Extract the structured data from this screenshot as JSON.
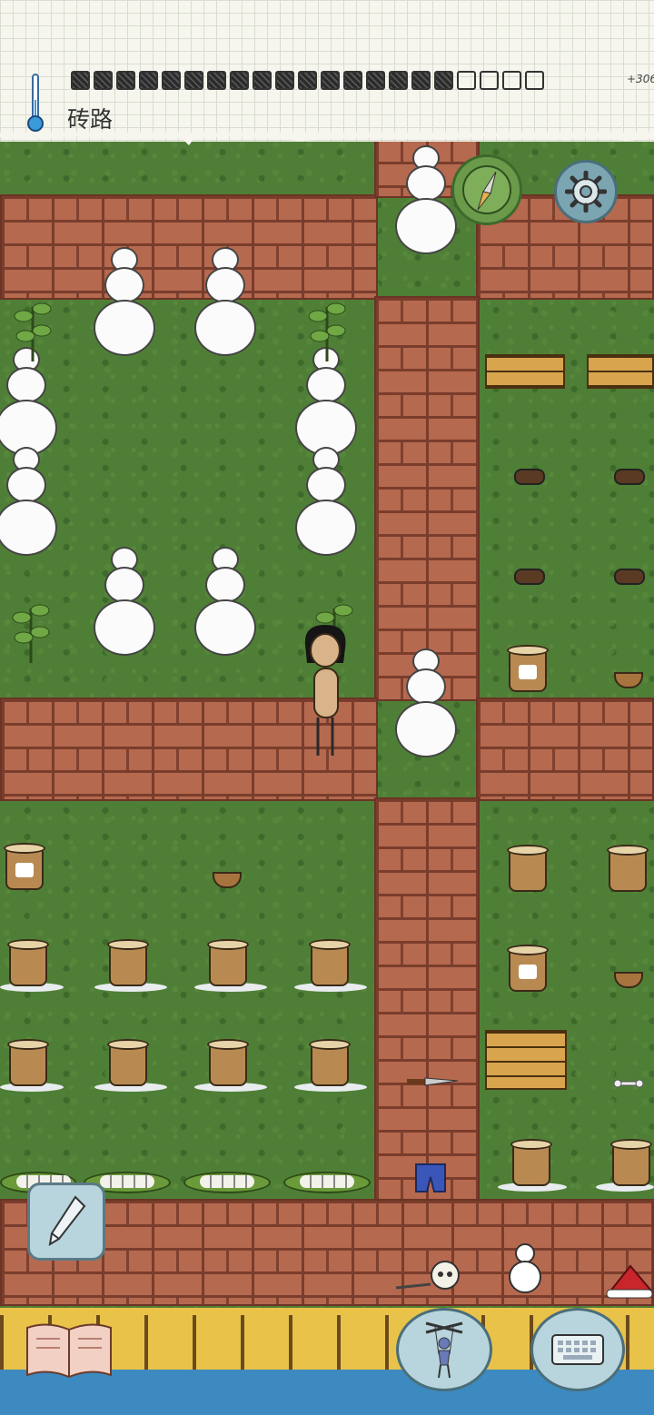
{
  "hud": {
    "biome": "砖路",
    "food_bonus": "+306",
    "food_pips": [
      "full",
      "full",
      "full",
      "full",
      "full",
      "full",
      "full",
      "full",
      "full",
      "full",
      "full",
      "full",
      "full",
      "full",
      "full",
      "full",
      "full",
      "empty",
      "empty",
      "empty",
      "empty"
    ]
  },
  "icons": {
    "temperature": "thermometer-icon",
    "compass": "compass-icon",
    "settings": "gear-icon",
    "edit": "pencil-icon",
    "tech_tree": "book-icon",
    "emote": "puppet-icon",
    "chat": "keyboard-icon"
  },
  "colors": {
    "grass": "#4f7f36",
    "brick": "#b5694f",
    "hud_paper": "#f7f6ee",
    "button_blue": "#b8d4dd",
    "compass_green": "#6a9a4a"
  }
}
